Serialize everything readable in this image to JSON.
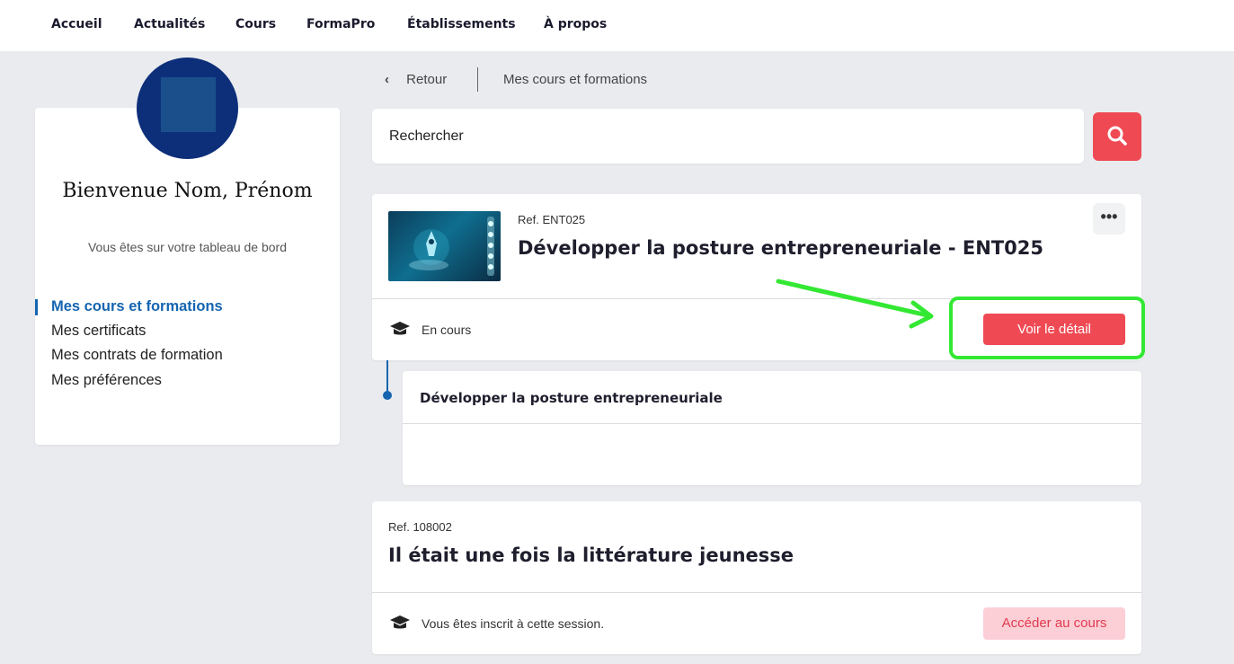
{
  "nav": {
    "items": [
      "Accueil",
      "Actualités",
      "Cours",
      "FormaPro",
      "Établissements",
      "À propos"
    ]
  },
  "sidebar": {
    "welcome": "Bienvenue Nom, Prénom",
    "subtitle": "Vous êtes sur votre tableau de bord",
    "items": [
      {
        "label": "Mes cours et formations",
        "active": true
      },
      {
        "label": "Mes certificats",
        "active": false
      },
      {
        "label": "Mes contrats de formation",
        "active": false
      },
      {
        "label": "Mes préférences",
        "active": false
      }
    ]
  },
  "breadcrumb": {
    "back_label": "Retour",
    "current": "Mes cours et formations"
  },
  "search": {
    "placeholder": "Rechercher",
    "button_icon": "search-icon"
  },
  "courses": [
    {
      "ref": "Ref. ENT025",
      "title": "Développer la posture entrepreneuriale - ENT025",
      "status": "En cours",
      "status_icon": "graduation-cap-icon",
      "action": "Voir le détail",
      "menu_icon": "more-horizontal-icon",
      "sub_title": "Développer la posture entrepreneuriale"
    },
    {
      "ref": "Ref. 108002",
      "title": "Il était une fois la littérature jeunesse",
      "status": "Vous êtes inscrit à cette session.",
      "status_icon": "graduation-cap-icon",
      "action": "Accéder au cours"
    }
  ],
  "colors": {
    "accent_red": "#ef4a54",
    "active_blue": "#1565b0",
    "highlight_green": "#33e833",
    "avatar_navy": "#0d2f7a"
  }
}
